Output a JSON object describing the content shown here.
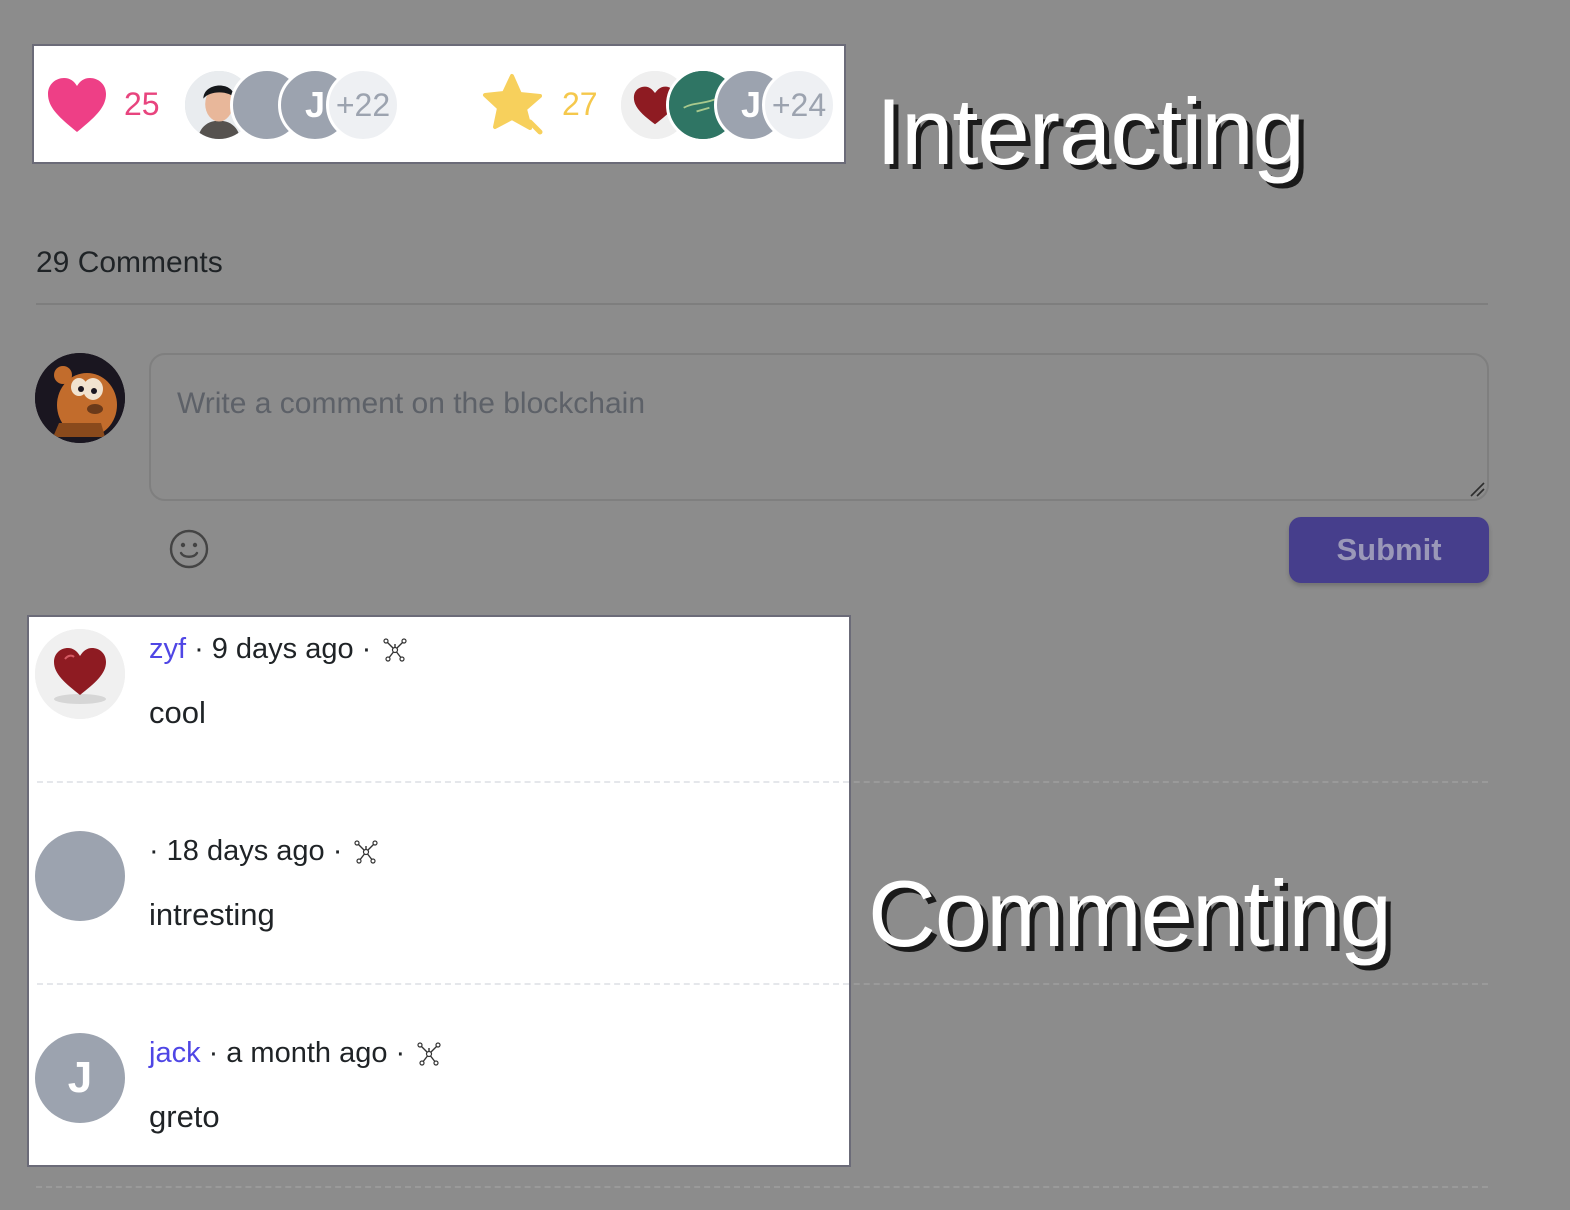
{
  "interacting": {
    "label": "Interacting",
    "likes": {
      "icon": "heart-icon",
      "color": "#e8447e",
      "count": "25",
      "avatars": [
        {
          "kind": "photo-man"
        },
        {
          "kind": "blank"
        },
        {
          "kind": "letter",
          "text": "J"
        },
        {
          "kind": "more",
          "text": "+22"
        }
      ]
    },
    "collects": {
      "icon": "star-icon",
      "color": "#f5c84c",
      "count": "27",
      "avatars": [
        {
          "kind": "heart"
        },
        {
          "kind": "green"
        },
        {
          "kind": "letter",
          "text": "J"
        },
        {
          "kind": "more",
          "text": "+24"
        }
      ]
    }
  },
  "comments_section": {
    "heading": "29 Comments",
    "input_placeholder": "Write a comment on the blockchain",
    "emoji_icon": "smiley-icon",
    "submit_label": "Submit",
    "accent": "#463e8c"
  },
  "commenting": {
    "label": "Commenting"
  },
  "comments": [
    {
      "author": "zyf",
      "time": "9 days ago",
      "text": "cool",
      "avatar": "heart"
    },
    {
      "author": "",
      "time": "18 days ago",
      "text": "intresting",
      "avatar": "blank"
    },
    {
      "author": "jack",
      "time": "a month ago",
      "text": "greto",
      "avatar": "letter",
      "initial": "J"
    }
  ],
  "colors": {
    "author_link": "#4f46e5",
    "avatar_gray": "#9ca3af"
  }
}
